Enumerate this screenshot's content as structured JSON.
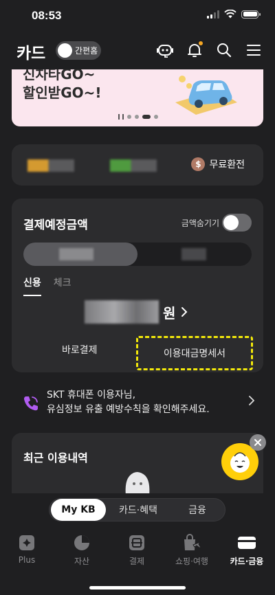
{
  "status_bar": {
    "time": "08:53"
  },
  "header": {
    "title": "카드",
    "mode_toggle_label": "간편홈"
  },
  "banner": {
    "line1": "신차타GO~",
    "line2": "할인받GO~!"
  },
  "points": {
    "exchange_label": "무료환전",
    "coin_symbol": "$"
  },
  "payment": {
    "title": "결제예정금액",
    "hide_label": "금액숨기기",
    "tabs": [
      "신용",
      "체크"
    ],
    "currency_unit": "원",
    "action_left": "바로결제",
    "action_right": "이용대금명세서"
  },
  "notice": {
    "line1": "SKT 휴대폰 이용자님,",
    "line2": "유심정보 유출 예방수칙을 확인해주세요."
  },
  "recent": {
    "title": "최근 이용내역"
  },
  "mode_switch": {
    "options": [
      "My KB",
      "카드·혜택",
      "금융"
    ],
    "selected": "My KB"
  },
  "bottom_nav": {
    "items": [
      "Plus",
      "자산",
      "결제",
      "쇼핑·여행",
      "카드·금융"
    ],
    "selected": "카드·금융"
  },
  "colors": {
    "highlight_border": "#f4ea0a",
    "notif_dot": "#f5a623",
    "mascot_bg": "#ffcf0a"
  }
}
